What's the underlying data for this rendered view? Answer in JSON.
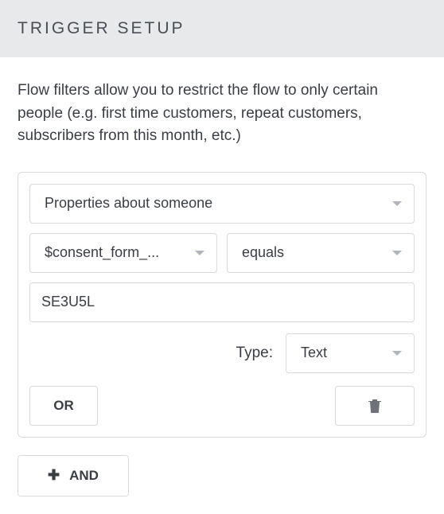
{
  "header": {
    "title": "TRIGGER SETUP"
  },
  "description": "Flow filters allow you to restrict the flow to only certain people (e.g. first time customers, repeat customers, subscribers from this month, etc.)",
  "filter": {
    "category": "Properties about someone",
    "property": "$consent_form_...",
    "operator": "equals",
    "value": "SE3U5L",
    "type_label": "Type:",
    "type_value": "Text",
    "or_label": "OR"
  },
  "and_label": "AND",
  "colors": {
    "border": "#d8dade",
    "text": "#3a3e44",
    "header_bg": "#e8e9ea",
    "chevron": "#b1b5bb",
    "trash": "#6f7379"
  }
}
